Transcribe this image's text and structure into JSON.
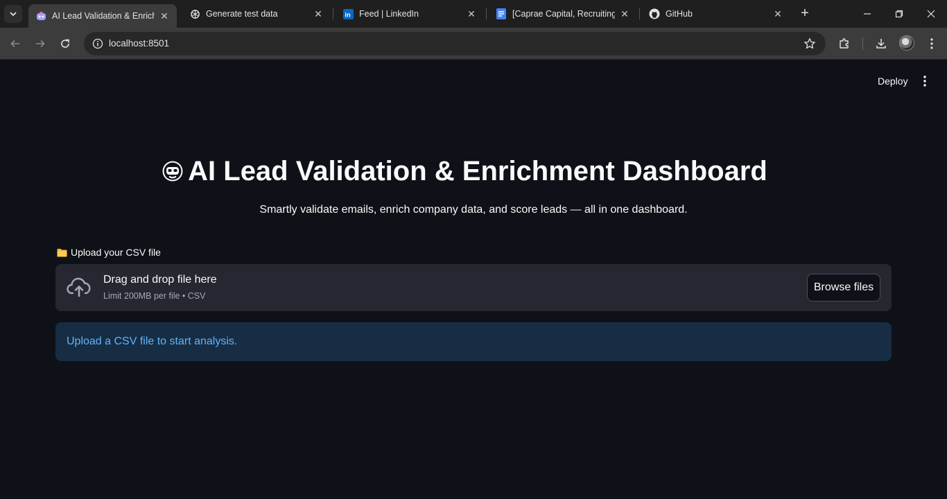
{
  "browser": {
    "tabs": [
      {
        "title": "AI Lead Validation & Enrichm",
        "favicon": "streamlit-icon",
        "active": true
      },
      {
        "title": "Generate test data",
        "favicon": "openai-icon",
        "active": false
      },
      {
        "title": "Feed | LinkedIn",
        "favicon": "linkedin-icon",
        "active": false
      },
      {
        "title": "[Caprae Capital, Recruiting] /",
        "favicon": "docs-icon",
        "active": false
      },
      {
        "title": "GitHub",
        "favicon": "github-icon",
        "active": false
      }
    ],
    "url": "localhost:8501"
  },
  "app": {
    "deploy_label": "Deploy",
    "title": "AI Lead Validation & Enrichment Dashboard",
    "subtitle": "Smartly validate emails, enrich company data, and score leads — all in one dashboard.",
    "uploader": {
      "label": "Upload your CSV file",
      "drop_title": "Drag and drop file here",
      "drop_subtitle": "Limit 200MB per file • CSV",
      "browse_label": "Browse files"
    },
    "info_message": "Upload a CSV file to start analysis.",
    "colors": {
      "background": "#0e1117",
      "dropzone": "#262730",
      "info_bg": "#172d43",
      "info_text": "#60b4ff"
    }
  }
}
